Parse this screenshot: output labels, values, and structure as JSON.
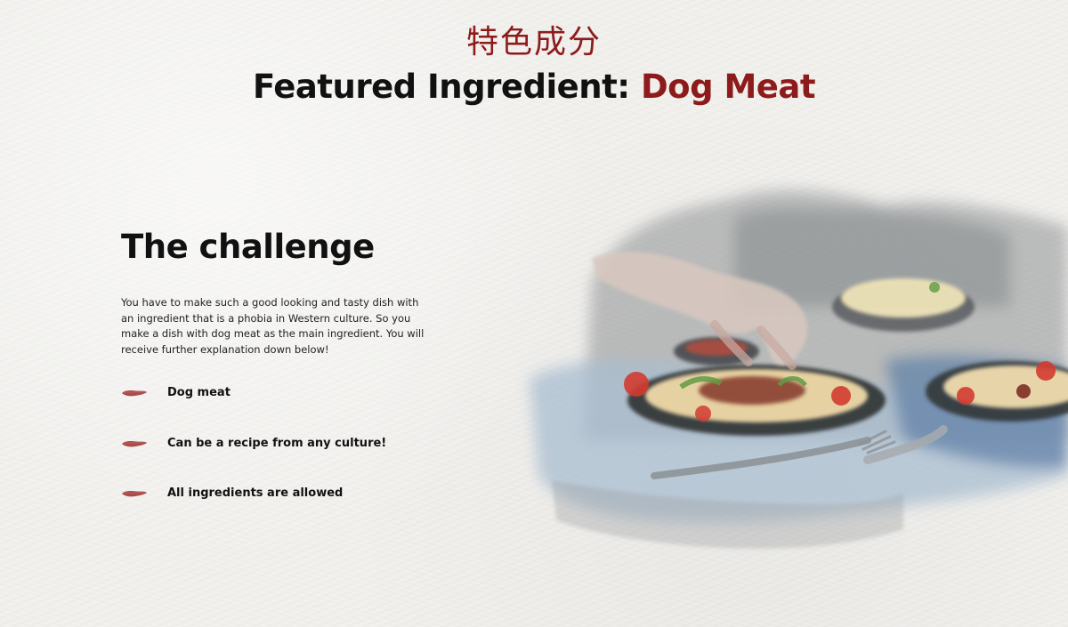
{
  "header": {
    "chinese_title": "特色成分",
    "title_prefix": "Featured Ingredient: ",
    "title_highlight": "Dog Meat"
  },
  "challenge": {
    "heading": "The challenge",
    "description": "You have to make such a good looking and tasty dish with an ingredient that is a phobia in Western culture. So you make a dish with dog meat as the main ingredient. You will receive further explanation down below!",
    "bullets": [
      {
        "label": "Dog meat"
      },
      {
        "label": "Can be a recipe from any culture!"
      },
      {
        "label": "All ingredients are allowed"
      }
    ]
  },
  "colors": {
    "accent": "#8e1b1b",
    "text": "#111111",
    "background": "#f2f1ee"
  },
  "icons": {
    "bullet": "brush-stroke-icon"
  }
}
